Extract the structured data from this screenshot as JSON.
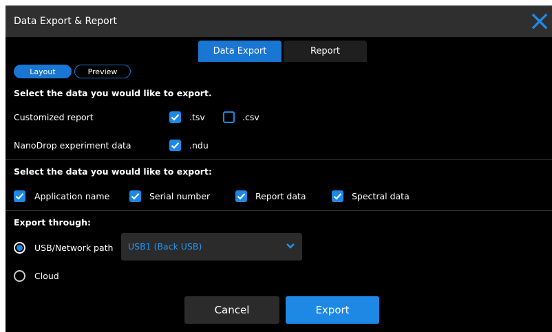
{
  "window": {
    "title": "Data Export & Report"
  },
  "tabs": [
    {
      "label": "Data Export",
      "active": true
    },
    {
      "label": "Report",
      "active": false
    }
  ],
  "subtabs": [
    {
      "label": "Layout",
      "active": true
    },
    {
      "label": "Preview",
      "active": false
    }
  ],
  "section1": {
    "heading": "Select the data you would like to export.",
    "rows": [
      {
        "label": "Customized report",
        "options": [
          {
            "label": ".tsv",
            "checked": true
          },
          {
            "label": ".csv",
            "checked": false
          }
        ]
      },
      {
        "label": "NanoDrop experiment data",
        "options": [
          {
            "label": ".ndu",
            "checked": true
          }
        ]
      }
    ]
  },
  "section2": {
    "heading": "Select the data you would like to export:",
    "options": [
      {
        "label": "Application name",
        "checked": true
      },
      {
        "label": "Serial number",
        "checked": true
      },
      {
        "label": "Report data",
        "checked": true
      },
      {
        "label": "Spectral data",
        "checked": true
      }
    ]
  },
  "section3": {
    "heading": "Export through:",
    "options": [
      {
        "label": "USB/Network path",
        "selected": true
      },
      {
        "label": "Cloud",
        "selected": false
      }
    ],
    "dropdown": {
      "value": "USB1 (Back USB)"
    }
  },
  "buttons": {
    "cancel": "Cancel",
    "export": "Export"
  },
  "colors": {
    "accent": "#1e88e5",
    "titlebar": "#2f2f2f",
    "background": "#000000",
    "close_icon": "#1e88e5"
  },
  "icons": {
    "close": "close-icon",
    "check": "checkmark-icon",
    "dropdown": "chevron-down-icon"
  }
}
